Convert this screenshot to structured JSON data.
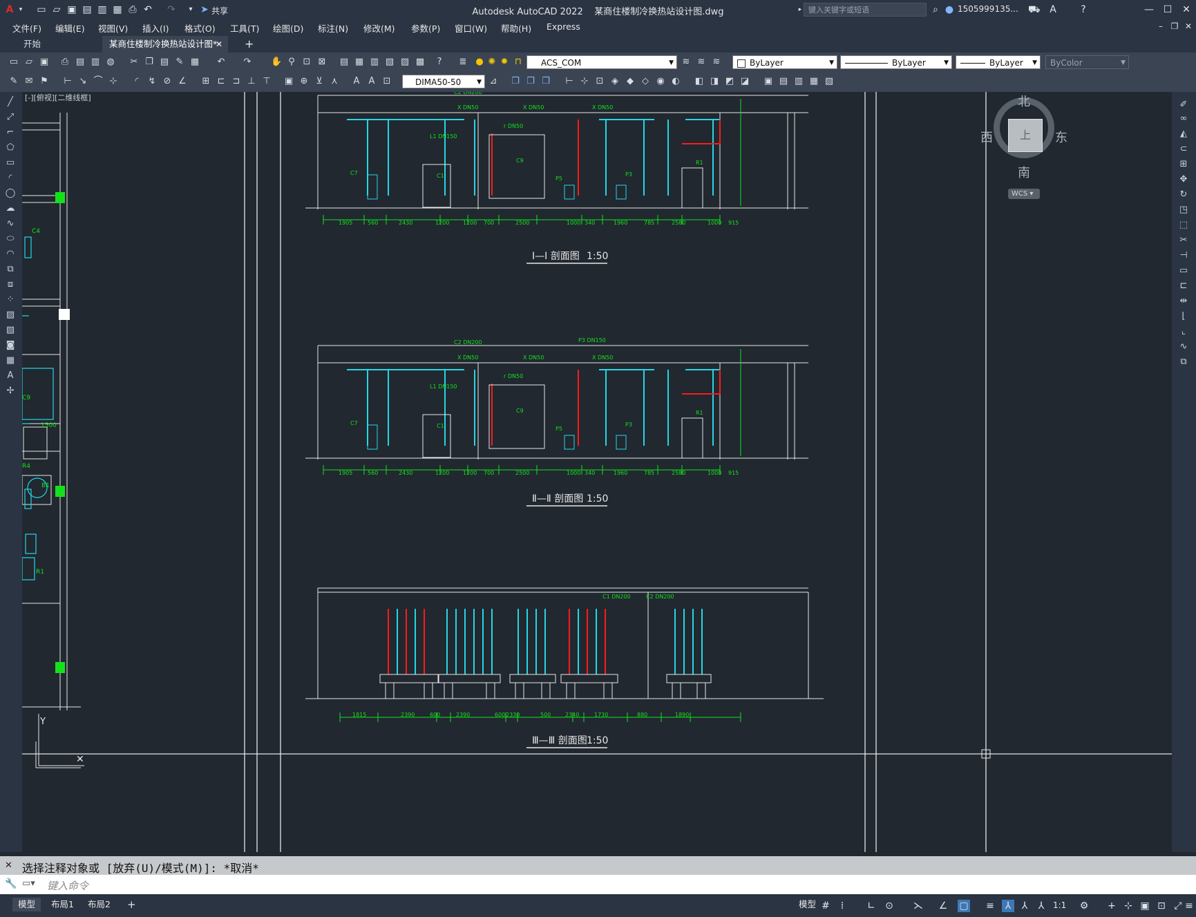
{
  "titlebar": {
    "app_title": "Autodesk AutoCAD 2022",
    "file_name": "某商住楼制冷换热站设计图.dwg",
    "share_label": "共享",
    "search_placeholder": "键入关键字或短语",
    "user_name": "1505999135..."
  },
  "menubar": {
    "items": [
      "文件(F)",
      "编辑(E)",
      "视图(V)",
      "插入(I)",
      "格式(O)",
      "工具(T)",
      "绘图(D)",
      "标注(N)",
      "修改(M)",
      "参数(P)",
      "窗口(W)",
      "帮助(H)",
      "Express"
    ]
  },
  "tabs": {
    "start": "开始",
    "active": "某商住楼制冷换热站设计图*"
  },
  "toolbar1": {
    "ucs_combo": "ACS_COM",
    "color_combo": "ByLayer",
    "linetype_combo": "ByLayer",
    "lineweight_combo": "ByLayer",
    "plotstyle_combo": "ByColor"
  },
  "toolbar2": {
    "dimstyle_combo": "DIMA50-50"
  },
  "viewport_label": "[-][俯视][二维线框]",
  "viewcube": {
    "north": "北",
    "south": "南",
    "east": "东",
    "west": "西",
    "top": "上",
    "wcs": "WCS"
  },
  "sections": [
    {
      "title": "Ⅰ—Ⅰ 剖面图",
      "scale": "1:50"
    },
    {
      "title": "Ⅱ—Ⅱ 剖面图",
      "scale": "1:50"
    },
    {
      "title": "Ⅲ—Ⅲ 剖面图",
      "scale": "1:50"
    }
  ],
  "section_dims": [
    "1905",
    "560",
    "2430",
    "1200",
    "1200",
    "700",
    "2500",
    "1000",
    "340",
    "1960",
    "785",
    "2580",
    "1000",
    "915"
  ],
  "section3_dims": [
    "1815",
    "2390",
    "600",
    "2390",
    "600",
    "2330",
    "500",
    "2340",
    "1730",
    "880",
    "1890"
  ],
  "pipe_labels": {
    "c2": "C2 DN200",
    "p3": "P3 DN150",
    "x1": "X DN50",
    "x2": "X DN50",
    "x3": "X DN50",
    "l1": "L1 DN150",
    "r1": "r DN50",
    "c1_3": "C1 DN200",
    "c2_3": "C2 DN200"
  },
  "equipment_labels": {
    "c7": "C7",
    "c1": "C1",
    "c9": "C9",
    "p5": "P5",
    "p3": "P3",
    "r1": "R1"
  },
  "left_plan_labels": [
    "C4",
    "C9",
    "1500",
    "R4",
    "B1",
    "R1"
  ],
  "command": {
    "history": "选择注释对象或 [放弃(U)/模式(M)]: *取消*",
    "placeholder": "键入命令"
  },
  "layout_tabs": [
    "模型",
    "布局1",
    "布局2"
  ],
  "status": {
    "model": "模型",
    "scale": "1:1"
  }
}
